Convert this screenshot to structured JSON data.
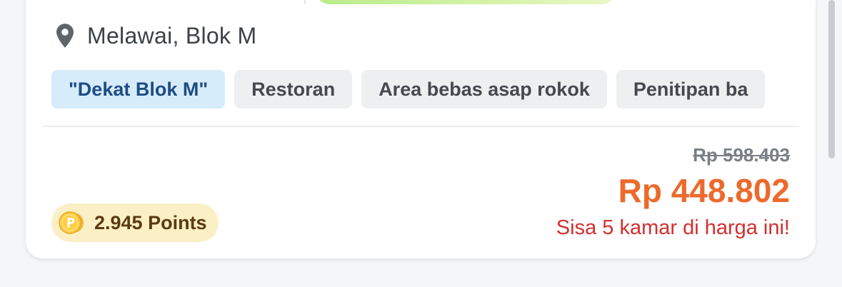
{
  "location": {
    "icon": "location-pin-icon",
    "text": "Melawai, Blok M"
  },
  "chips": [
    {
      "label": "\"Dekat Blok M\"",
      "active": true
    },
    {
      "label": "Restoran",
      "active": false
    },
    {
      "label": "Area bebas asap rokok",
      "active": false
    },
    {
      "label": "Penitipan ba",
      "active": false
    }
  ],
  "points": {
    "icon": "points-coin-icon",
    "label": "2.945 Points"
  },
  "price": {
    "original": "Rp 598.403",
    "current": "Rp 448.802",
    "note": "Sisa 5 kamar di harga ini!"
  },
  "colors": {
    "accent_price": "#ec6a2c",
    "warning_text": "#d32f2f",
    "active_chip_bg": "#d6ecfb",
    "active_chip_text": "#1e4c86",
    "points_bg": "#fbefc6"
  }
}
